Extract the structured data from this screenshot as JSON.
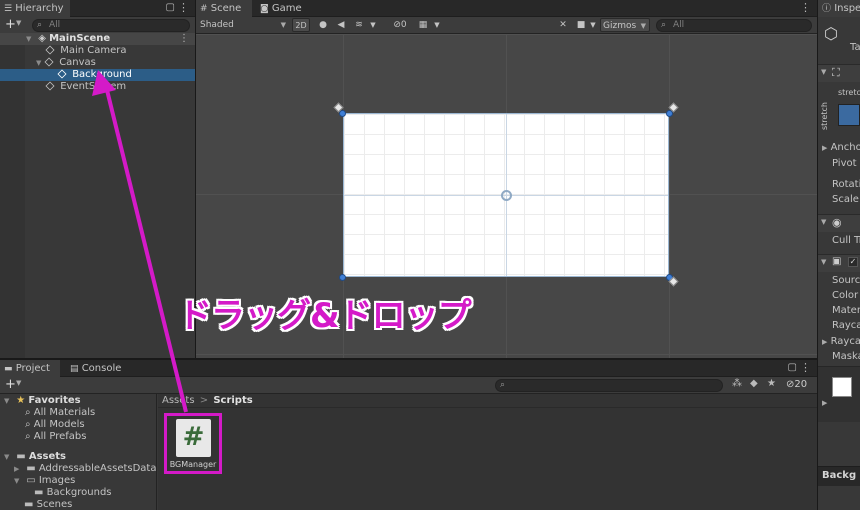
{
  "hierarchy": {
    "tab_label": "Hierarchy",
    "add_label": "+",
    "search_placeholder": "All",
    "scene_name": "MainScene",
    "items": [
      {
        "label": "Main Camera"
      },
      {
        "label": "Canvas"
      },
      {
        "label": "Background"
      },
      {
        "label": "EventSystem"
      }
    ]
  },
  "scene_view": {
    "tabs": [
      {
        "label": "Scene"
      },
      {
        "label": "Game"
      }
    ],
    "shading_mode": "Shaded",
    "mode_2d": "2D",
    "hidden_count": "0",
    "gizmos_label": "Gizmos",
    "search_placeholder": "All"
  },
  "inspector": {
    "tab_label": "Inspe",
    "tag_label": "Ta",
    "anchor_preset_label": "stretc",
    "anchor_preset_side": "stretch",
    "fields": [
      {
        "label": "Ancho"
      },
      {
        "label": "Pivot"
      },
      {
        "label": "Rotati"
      },
      {
        "label": "Scale"
      },
      {
        "label": "Cull Tr"
      },
      {
        "label": "Sourc"
      },
      {
        "label": "Color"
      },
      {
        "label": "Mater"
      },
      {
        "label": "Rayca"
      },
      {
        "label": "Rayca"
      },
      {
        "label": "Maska"
      }
    ],
    "bottom_label": "Backg"
  },
  "project": {
    "tabs": [
      {
        "label": "Project"
      },
      {
        "label": "Console"
      }
    ],
    "add_label": "+",
    "hidden_count": "20",
    "favorites_label": "Favorites",
    "favorites": [
      {
        "label": "All Materials"
      },
      {
        "label": "All Models"
      },
      {
        "label": "All Prefabs"
      }
    ],
    "assets_label": "Assets",
    "assets": [
      {
        "label": "AddressableAssetsData"
      },
      {
        "label": "Images"
      },
      {
        "label": "Backgrounds"
      },
      {
        "label": "Scenes"
      }
    ],
    "breadcrumb": [
      {
        "label": "Assets"
      },
      {
        "label": "Scripts"
      }
    ],
    "breadcrumb_sep": ">",
    "file": {
      "name": "BGManager",
      "icon_glyph": "#"
    }
  },
  "annotation": {
    "text": "ドラッグ&ドロップ",
    "color": "#d41ac8"
  },
  "colors": {
    "selection": "#2c5d87",
    "canvas": "#ffffff",
    "accent_magenta": "#d41ac8"
  }
}
